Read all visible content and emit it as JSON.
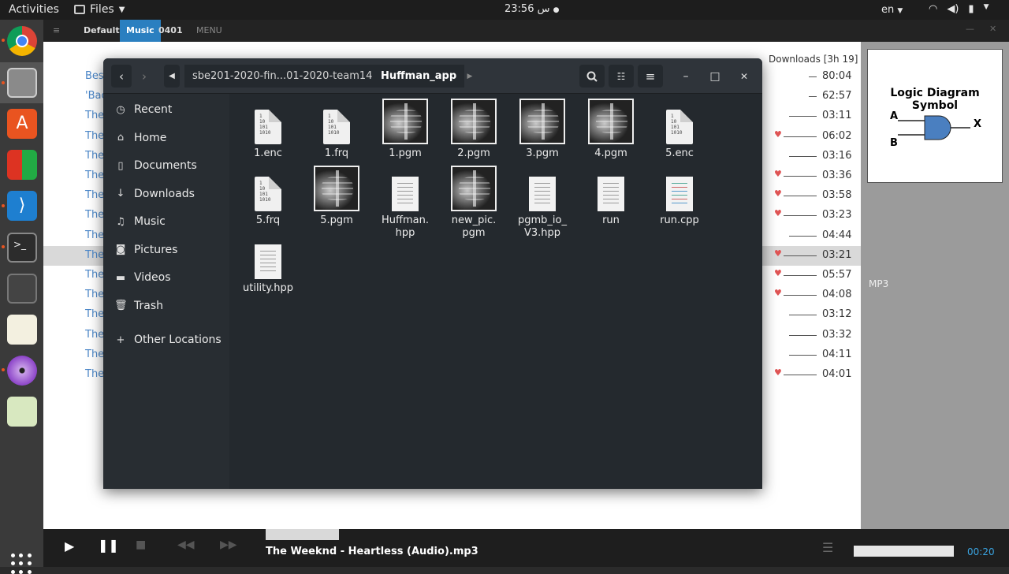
{
  "topbar": {
    "activities": "Activities",
    "app_menu": "Files",
    "clock": "23:56 س",
    "language": "en"
  },
  "player": {
    "tabs": [
      "Default",
      "Music",
      "0401",
      "MENU"
    ],
    "downloads_label": "Downloads",
    "downloads_duration": "[3h 19]",
    "track_prefix": [
      "Bes",
      "'Bac",
      "The",
      "The",
      "The",
      "The",
      "The",
      "The",
      "The",
      "The",
      "The",
      "The",
      "The",
      "The",
      "The",
      "The"
    ],
    "durations": [
      "80:04",
      "62:57",
      "03:11",
      "06:02",
      "03:16",
      "03:36",
      "03:58",
      "03:23",
      "04:44",
      "03:21",
      "05:57",
      "04:08",
      "03:12",
      "03:32",
      "04:11",
      "04:01"
    ],
    "favorite": [
      false,
      false,
      false,
      true,
      false,
      true,
      true,
      true,
      false,
      true,
      true,
      true,
      false,
      false,
      false,
      true
    ],
    "selected_row": 9,
    "side_image_title": "Logic Diagram Symbol",
    "side_image_labels": [
      "A",
      "B",
      "X"
    ],
    "format_label": "MP3",
    "now_playing": "The Weeknd - Heartless (Audio).mp3",
    "elapsed": "00:20",
    "accent": "#3aa3e0"
  },
  "files_window": {
    "path_parent": "sbe201-2020-fin...01-2020-team14",
    "path_current": "Huffman_app",
    "sidebar": [
      {
        "label": "Recent",
        "icon": "clock-icon"
      },
      {
        "label": "Home",
        "icon": "home-icon"
      },
      {
        "label": "Documents",
        "icon": "document-icon"
      },
      {
        "label": "Downloads",
        "icon": "download-icon"
      },
      {
        "label": "Music",
        "icon": "music-icon"
      },
      {
        "label": "Pictures",
        "icon": "camera-icon"
      },
      {
        "label": "Videos",
        "icon": "video-icon"
      },
      {
        "label": "Trash",
        "icon": "trash-icon"
      },
      {
        "label": "Other Locations",
        "icon": "plus-icon"
      }
    ],
    "files": [
      {
        "name": "1.enc",
        "kind": "binary"
      },
      {
        "name": "1.frq",
        "kind": "binary"
      },
      {
        "name": "1.pgm",
        "kind": "image"
      },
      {
        "name": "2.pgm",
        "kind": "image"
      },
      {
        "name": "3.pgm",
        "kind": "image"
      },
      {
        "name": "4.pgm",
        "kind": "image"
      },
      {
        "name": "5.enc",
        "kind": "binary"
      },
      {
        "name": "5.frq",
        "kind": "binary"
      },
      {
        "name": "5.pgm",
        "kind": "image"
      },
      {
        "name": "Huffman.\nhpp",
        "kind": "text"
      },
      {
        "name": "new_pic.\npgm",
        "kind": "image"
      },
      {
        "name": "pgmb_io_\nV3.hpp",
        "kind": "text"
      },
      {
        "name": "run",
        "kind": "text"
      },
      {
        "name": "run.cpp",
        "kind": "cpp"
      },
      {
        "name": "utility.hpp",
        "kind": "text"
      }
    ],
    "binary_glyph": "1\n10\n101\n1010"
  }
}
